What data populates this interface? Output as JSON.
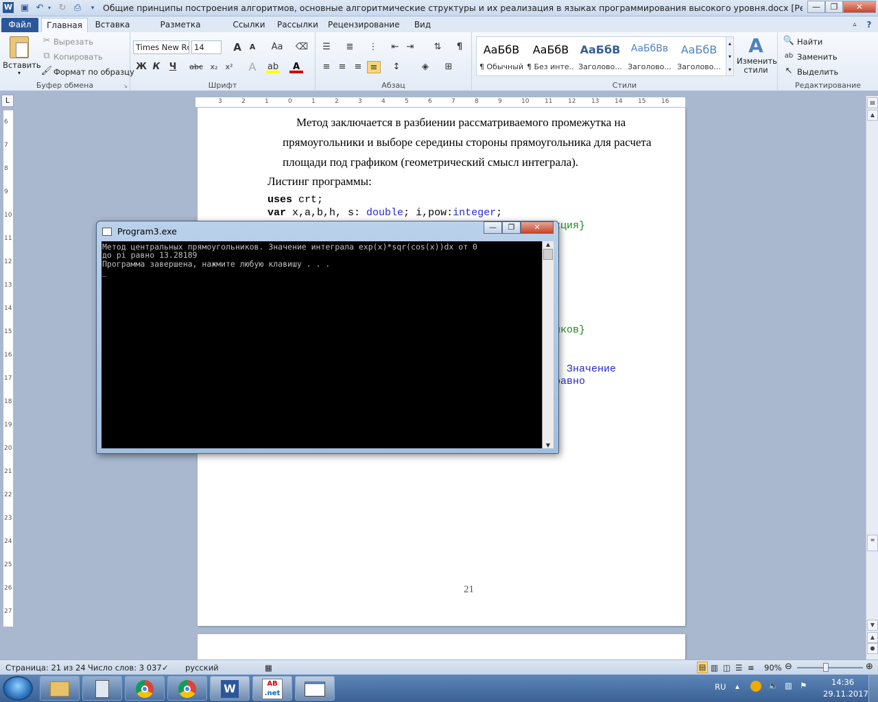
{
  "window": {
    "title": "Общие принципы построения алгоритмов, основные алгоритмические структуры и их реализация в языках программирования высокого уровня.docx [Режим ограниченной функ...",
    "minimize": "—",
    "maximize": "❐",
    "close": "✕"
  },
  "tabs": [
    "Файл",
    "Главная",
    "Вставка",
    "Разметка страницы",
    "Ссылки",
    "Рассылки",
    "Рецензирование",
    "Вид"
  ],
  "ribbon": {
    "clipboard": {
      "paste": "Вставить",
      "cut": "Вырезать",
      "copy": "Копировать",
      "format_painter": "Формат по образцу",
      "label": "Буфер обмена"
    },
    "font": {
      "name": "Times New Rc",
      "size": "14",
      "label": "Шрифт",
      "bold": "Ж",
      "italic": "К",
      "underline": "Ч",
      "strike": "abc",
      "sub": "x₂",
      "sup": "x²",
      "grow": "A",
      "shrink": "A",
      "case": "Aa"
    },
    "paragraph": {
      "label": "Абзац",
      "pilcrow": "¶"
    },
    "styles": {
      "label": "Стили",
      "items": [
        {
          "sample": "АаБбВ",
          "name": "¶ Обычный"
        },
        {
          "sample": "АаБбВ",
          "name": "¶ Без инте..."
        },
        {
          "sample": "АаБбВ",
          "name": "Заголово..."
        },
        {
          "sample": "АаБбВв",
          "name": "Заголово..."
        },
        {
          "sample": "АаБбВ",
          "name": "Заголово..."
        }
      ],
      "change_styles": "Изменить стили"
    },
    "editing": {
      "find": "Найти",
      "replace": "Заменить",
      "select": "Выделить",
      "label": "Редактирование"
    }
  },
  "document": {
    "para1_line1": "Метод  заключается  в  разбиении  рассматриваемого  промежутка  на",
    "para1_line2": "прямоугольники и выборе середины стороны прямоугольника для расчета",
    "para1_line3": "площади под графиком (геометрический смысл интеграла).",
    "listing_title": "Листинг программы:",
    "code1_kw": "uses",
    "code1_rest": " crt;",
    "code2_kw": "var",
    "code2_a": "  x,a,b,h, s: ",
    "code2_b": "double",
    "code2_c": "; i,pow:",
    "code2_d": "integer",
    "code2_e": ";",
    "code3_tail": "кция}",
    "code4_tail": "иков}",
    "code5_tail": ". Значение",
    "code6_tail": "равно",
    "page_number": "21"
  },
  "console": {
    "title": "Program3.exe",
    "lines": [
      "Метод центральных прямоугольников. Значение интеграла exp(x)*sqr(cos(x))dx от 0",
      "до pi равно 13.28189",
      "Программа завершена, нажмите любую клавишу . . .",
      "_"
    ]
  },
  "status": {
    "page": "Страница: 21 из 24",
    "words": "Число слов: 3 037",
    "language": "русский",
    "zoom": "90%"
  },
  "tray": {
    "lang": "RU",
    "time": "14:36",
    "date": "29.11.2017"
  },
  "colors": {
    "file_tab": "#2b579a",
    "console_bg": "#000000",
    "code_blue": "#2626d0",
    "code_green": "#1b8a1b"
  }
}
